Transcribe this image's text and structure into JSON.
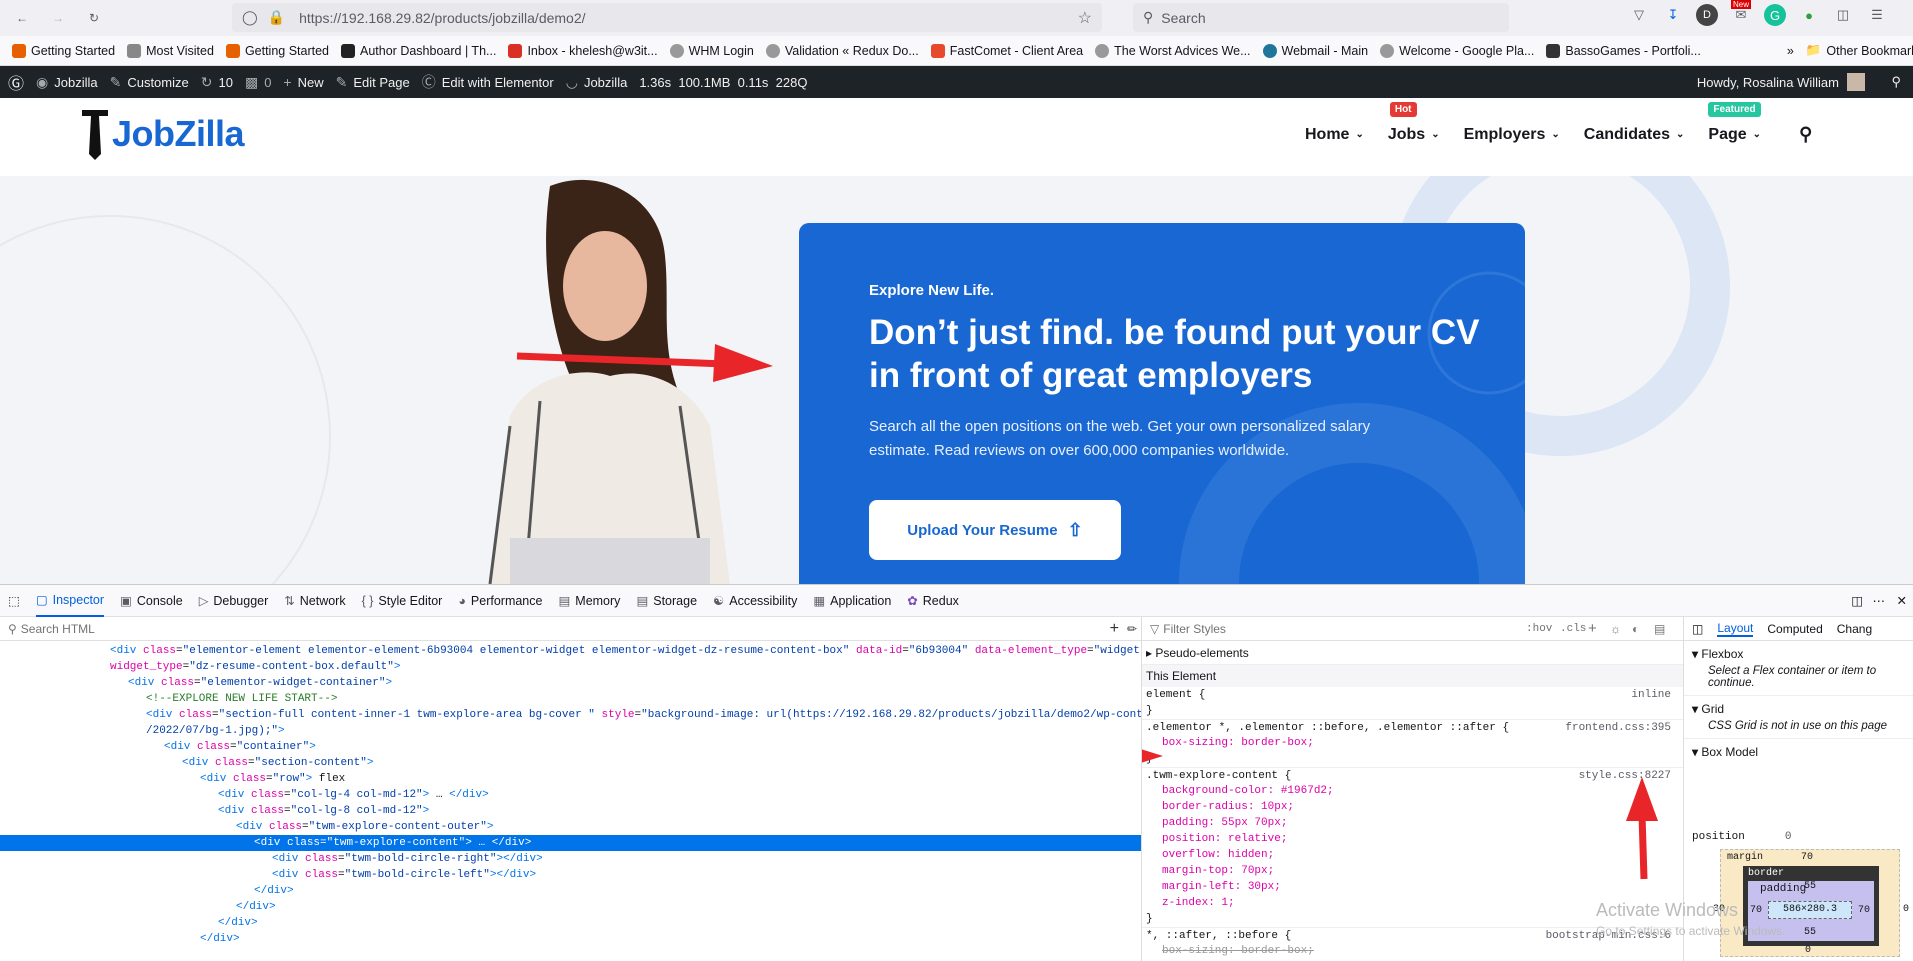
{
  "browser": {
    "url": "https://192.168.29.82/products/jobzilla/demo2/",
    "search_placeholder": "Search",
    "bookmarks": [
      "Getting Started",
      "Most Visited",
      "Getting Started",
      "Author Dashboard | Th...",
      "Inbox - khelesh@w3it...",
      "WHM Login",
      "Validation « Redux Do...",
      "FastComet - Client Area",
      "The Worst Advices We...",
      "Webmail - Main",
      "Welcome - Google Pla...",
      "BassoGames - Portfoli..."
    ],
    "other_bookmarks": "Other Bookmarks",
    "profile_letter": "D",
    "new_badge": "New"
  },
  "wpbar": {
    "site": "Jobzilla",
    "customize": "Customize",
    "updates": "10",
    "comments": "0",
    "new": "New",
    "edit_page": "Edit Page",
    "elementor": "Edit with Elementor",
    "site2": "Jobzilla",
    "stats": "1.36s  100.1MB  0.11s  228Q",
    "howdy": "Howdy, Rosalina William"
  },
  "site": {
    "logo": "JobZilla",
    "menu": [
      {
        "label": "Home",
        "badge": ""
      },
      {
        "label": "Jobs",
        "badge": "Hot"
      },
      {
        "label": "Employers",
        "badge": ""
      },
      {
        "label": "Candidates",
        "badge": ""
      },
      {
        "label": "Page",
        "badge": "Featured"
      }
    ],
    "hero": {
      "eyebrow": "Explore New Life.",
      "heading": "Don’t just find. be found put your CV in front of great employers",
      "description": "Search all the open positions on the web. Get your own personalized salary estimate. Read reviews on over 600,000 companies worldwide.",
      "button": "Upload Your Resume"
    },
    "colors": {
      "brand": "#1967d2",
      "hot": "#e53935",
      "featured": "#26c6a0"
    }
  },
  "devtools": {
    "tabs": [
      "Inspector",
      "Console",
      "Debugger",
      "Network",
      "Style Editor",
      "Performance",
      "Memory",
      "Storage",
      "Accessibility",
      "Application",
      "Redux"
    ],
    "search_html": "Search HTML",
    "filter_styles": "Filter Styles",
    "hov": ":hov",
    "cls": ".cls",
    "tree": [
      {
        "i": 0,
        "html": "<span class='tag'>&lt;div</span> <span class='an'>class</span>=<span class='av'>\"elementor-element elementor-element-6b93004 elementor-widget elementor-widget-dz-resume-content-box\"</span> <span class='an'>data-id</span>=<span class='av'>\"6b93004\"</span> <span class='an'>data-element_type</span>=<span class='av'>\"widget\"</span> <span class='an'>data-</span>"
      },
      {
        "i": 0,
        "html": "<span class='an'>widget_type</span>=<span class='av'>\"dz-resume-content-box.default\"</span><span class='tag'>&gt;</span>"
      },
      {
        "i": 1,
        "html": "<span class='tag'>&lt;div</span> <span class='an'>class</span>=<span class='av'>\"elementor-widget-container\"</span><span class='tag'>&gt;</span>"
      },
      {
        "i": 2,
        "html": "<span class='cm'>&lt;!--EXPLORE NEW LIFE START--&gt;</span>"
      },
      {
        "i": 2,
        "html": "<span class='tag'>&lt;div</span> <span class='an'>class</span>=<span class='av'>\"section-full content-inner-1 twm-explore-area bg-cover \"</span> <span class='an'>style</span>=<span class='av'>\"background-image: url(https://192.168.29.82/products/jobzilla/demo2/wp-content/uploads</span>"
      },
      {
        "i": 2,
        "html": "<span class='av'>/2022/07/bg-1.jpg);\"</span><span class='tag'>&gt;</span>"
      },
      {
        "i": 3,
        "html": "<span class='tag'>&lt;div</span> <span class='an'>class</span>=<span class='av'>\"container\"</span><span class='tag'>&gt;</span>"
      },
      {
        "i": 4,
        "html": "<span class='tag'>&lt;div</span> <span class='an'>class</span>=<span class='av'>\"section-content\"</span><span class='tag'>&gt;</span>"
      },
      {
        "i": 5,
        "html": "<span class='tag'>&lt;div</span> <span class='an'>class</span>=<span class='av'>\"row\"</span><span class='tag'>&gt;</span> flex"
      },
      {
        "i": 6,
        "html": "<span class='tag'>&lt;div</span> <span class='an'>class</span>=<span class='av'>\"col-lg-4 col-md-12\"</span><span class='tag'>&gt;</span> … <span class='tag'>&lt;/div&gt;</span>"
      },
      {
        "i": 6,
        "html": "<span class='tag'>&lt;div</span> <span class='an'>class</span>=<span class='av'>\"col-lg-8 col-md-12\"</span><span class='tag'>&gt;</span>"
      },
      {
        "i": 7,
        "html": "<span class='tag'>&lt;div</span> <span class='an'>class</span>=<span class='av'>\"twm-explore-content-outer\"</span><span class='tag'>&gt;</span>"
      },
      {
        "i": 8,
        "html": "<span class='tag'>&lt;div</span> <span class='an'>class</span>=<span class='av'>\"twm-explore-content\"</span><span class='tag'>&gt;</span> … <span class='tag'>&lt;/div&gt;</span>",
        "sel": true
      },
      {
        "i": 9,
        "html": "<span class='tag'>&lt;div</span> <span class='an'>class</span>=<span class='av'>\"twm-bold-circle-right\"</span><span class='tag'>&gt;&lt;/div&gt;</span>"
      },
      {
        "i": 9,
        "html": "<span class='tag'>&lt;div</span> <span class='an'>class</span>=<span class='av'>\"twm-bold-circle-left\"</span><span class='tag'>&gt;&lt;/div&gt;</span>"
      },
      {
        "i": 8,
        "html": "<span class='tag'>&lt;/div&gt;</span>"
      },
      {
        "i": 7,
        "html": "<span class='tag'>&lt;/div&gt;</span>"
      },
      {
        "i": 6,
        "html": "<span class='tag'>&lt;/div&gt;</span>"
      },
      {
        "i": 5,
        "html": "<span class='tag'>&lt;/div&gt;</span>"
      }
    ],
    "rules": {
      "pseudo": "Pseudo-elements",
      "this_element": "This Element",
      "element_sel": "element {",
      "element_src": "inline",
      "r1_sel": ".elementor *, .elementor ::before, .elementor ::after {",
      "r1_src": "frontend.css:395",
      "r1_prop": "box-sizing: border-box;",
      "r2_sel": ".twm-explore-content {",
      "r2_src": "style.css:8227",
      "r2_props": [
        "background-color: #1967d2;",
        "border-radius: 10px;",
        "padding: 55px 70px;",
        "position: relative;",
        "overflow: hidden;",
        "margin-top: 70px;",
        "margin-left: 30px;",
        "z-index: 1;"
      ],
      "r3_sel": "*, ::after, ::before {",
      "r3_src": "bootstrap-min.css:6",
      "r3_prop": "box-sizing: border-box;",
      "close": "}"
    },
    "layout": {
      "tabs": [
        "Layout",
        "Computed",
        "Chang"
      ],
      "flexbox": "Flexbox",
      "flexbox_note": "Select a Flex container or item to continue.",
      "grid": "Grid",
      "grid_note": "CSS Grid is not in use on this page",
      "boxmodel": "Box Model",
      "position_label": "position",
      "margin_label": "margin",
      "border_label": "border",
      "padding_label": "padding",
      "margin_top": "70",
      "margin_left": "30",
      "margin_right": "0",
      "margin_bottom": "0",
      "padding_top": "55",
      "padding_side": "70",
      "content_size": "586×280.3",
      "position_val": "0",
      "zero": "0"
    }
  },
  "watermark": {
    "line1": "Activate Windows",
    "line2": "Go to Settings to activate Windows."
  }
}
